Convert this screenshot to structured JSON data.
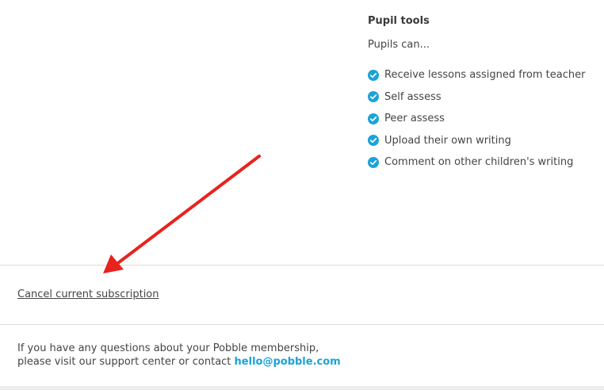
{
  "pupil_tools": {
    "title": "Pupil tools",
    "intro": "Pupils can...",
    "features": [
      "Receive lessons assigned from teacher",
      "Self assess",
      "Peer assess",
      "Upload their own writing",
      "Comment on other children's writing"
    ],
    "check_icon": "check-circle-icon",
    "check_color": "#1aa3d9"
  },
  "subscription": {
    "cancel_label": "Cancel current subscription"
  },
  "support": {
    "line1": "If you have any questions about your Pobble membership,",
    "line2": "please visit our support center or contact",
    "email": "hello@pobble.com",
    "link_color": "#1aa3d9"
  },
  "annotation": {
    "arrow_color": "#e8231e"
  }
}
